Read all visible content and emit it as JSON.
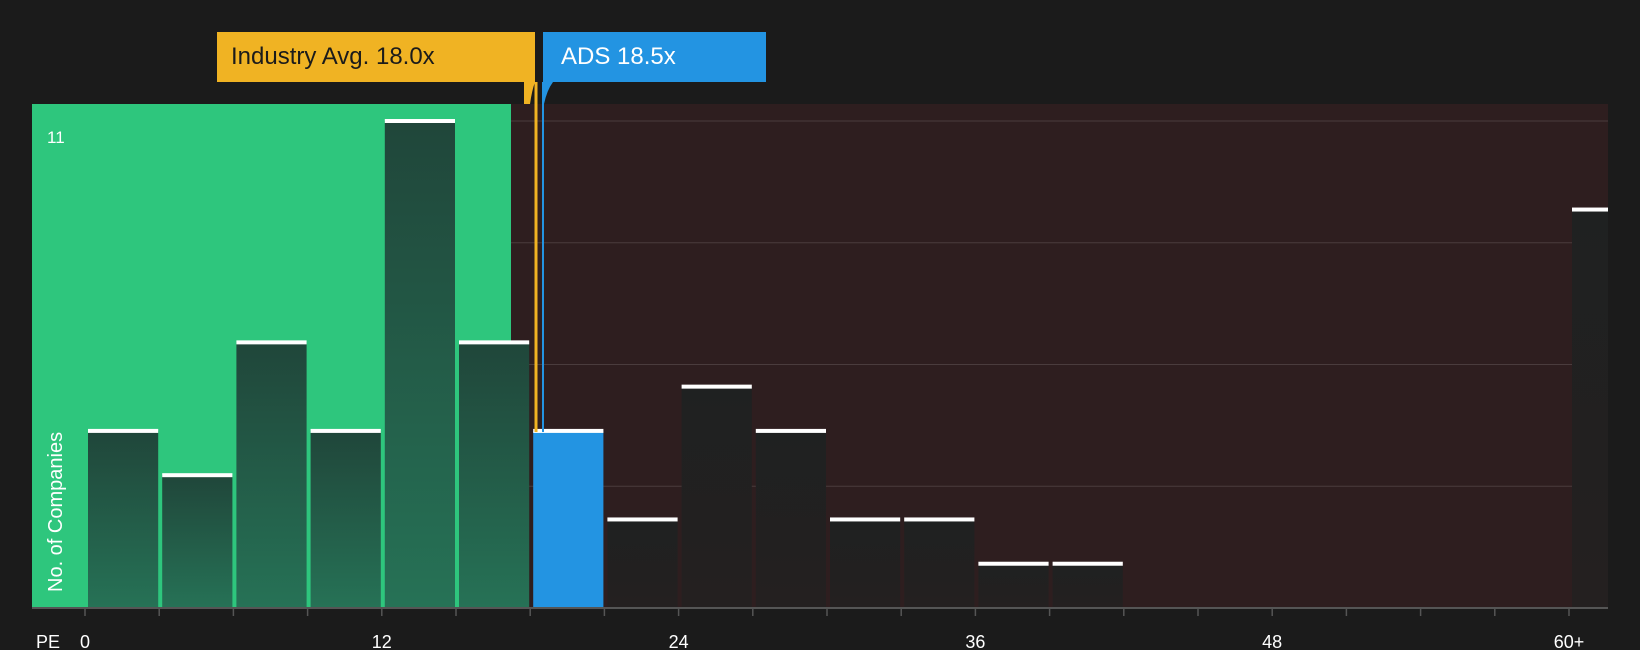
{
  "chart_data": {
    "type": "bar",
    "xlabel": "PE",
    "ylabel": "No. of Companies",
    "y_max_label": "11",
    "ylim": [
      0,
      11
    ],
    "x_ticks": [
      "0",
      "12",
      "24",
      "36",
      "48",
      "60+"
    ],
    "bins": [
      {
        "from": 0,
        "to": 3,
        "value": 4
      },
      {
        "from": 3,
        "to": 6,
        "value": 3
      },
      {
        "from": 6,
        "to": 9,
        "value": 6
      },
      {
        "from": 9,
        "to": 12,
        "value": 4
      },
      {
        "from": 12,
        "to": 15,
        "value": 11
      },
      {
        "from": 15,
        "to": 18,
        "value": 6
      },
      {
        "from": 18,
        "to": 21,
        "value": 4,
        "highlight": true
      },
      {
        "from": 21,
        "to": 24,
        "value": 2
      },
      {
        "from": 24,
        "to": 27,
        "value": 5
      },
      {
        "from": 27,
        "to": 30,
        "value": 4
      },
      {
        "from": 30,
        "to": 33,
        "value": 2
      },
      {
        "from": 33,
        "to": 36,
        "value": 2
      },
      {
        "from": 36,
        "to": 39,
        "value": 1
      },
      {
        "from": 39,
        "to": 42,
        "value": 1
      },
      {
        "from": 60,
        "to": 61.6,
        "value": 9
      }
    ],
    "industry_avg": {
      "label": "Industry Avg. 18.0x",
      "value": 18.0
    },
    "company": {
      "label": "ADS 18.5x",
      "value": 18.5
    },
    "colors": {
      "background": "#1b1b1b",
      "undervalued_zone": "#2ec67d",
      "overvalued_zone": "#2e1e1f",
      "bar_dark": "#1f2422",
      "industry": "#f0b323",
      "company": "#2394e2",
      "bar_top": "#ffffff",
      "text": "#ffffff"
    }
  }
}
